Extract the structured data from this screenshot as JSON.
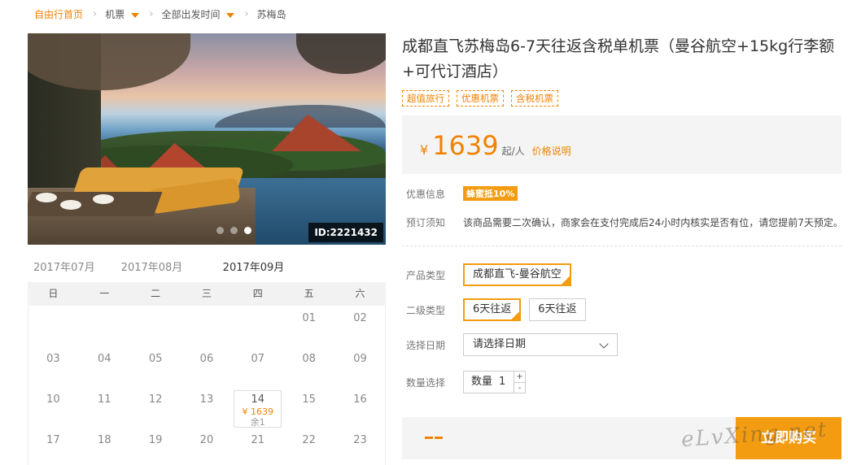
{
  "breadcrumb": {
    "home": "自由行首页",
    "category": "机票",
    "departure": "全部出发时间",
    "destination": "苏梅岛"
  },
  "hero": {
    "id_label": "ID:2221432",
    "slides": 3,
    "active_slide": 3
  },
  "product": {
    "title": "成都直飞苏梅岛6-7天往返含税单机票（曼谷航空+15kg行李额+可代订酒店）",
    "tags": [
      "超值旅行",
      "优惠机票",
      "含税机票"
    ]
  },
  "price": {
    "currency": "¥",
    "amount": "1639",
    "unit": "起/人",
    "explain_link": "价格说明"
  },
  "info": {
    "discount_label": "优惠信息",
    "discount_badge": "蜂蜜抵10%",
    "booking_label": "预订须知",
    "booking_text": "该商品需要二次确认，商家会在支付完成后24小时内核实是否有位，请您提前7天预定。"
  },
  "options": {
    "product_type_label": "产品类型",
    "product_types": [
      "成都直飞-曼谷航空"
    ],
    "sub_type_label": "二级类型",
    "sub_types": [
      "6天往返",
      "6天往返"
    ],
    "date_label": "选择日期",
    "date_placeholder": "请选择日期",
    "qty_label": "数量选择",
    "qty_field_label": "数量",
    "qty_value": "1",
    "plus": "+",
    "minus": "-"
  },
  "buy": {
    "button": "立即购买"
  },
  "watermark": "eLvXing.net",
  "calendar": {
    "months": [
      "2017年07月",
      "2017年08月",
      "2017年09月"
    ],
    "active_month": "2017年09月",
    "weekdays": [
      "日",
      "一",
      "二",
      "三",
      "四",
      "五",
      "六"
    ],
    "rows": [
      [
        "",
        "",
        "",
        "",
        "",
        "01",
        "02"
      ],
      [
        "03",
        "04",
        "05",
        "06",
        "07",
        "08",
        "09"
      ],
      [
        "10",
        "11",
        "12",
        "13",
        "14",
        "15",
        "16"
      ],
      [
        "17",
        "18",
        "19",
        "20",
        "21",
        "22",
        "23"
      ]
    ],
    "available": {
      "day": "14",
      "price": "¥ 1639",
      "remaining": "余1"
    }
  },
  "colors": {
    "accent": "#f08200",
    "badge": "#f39c12"
  }
}
